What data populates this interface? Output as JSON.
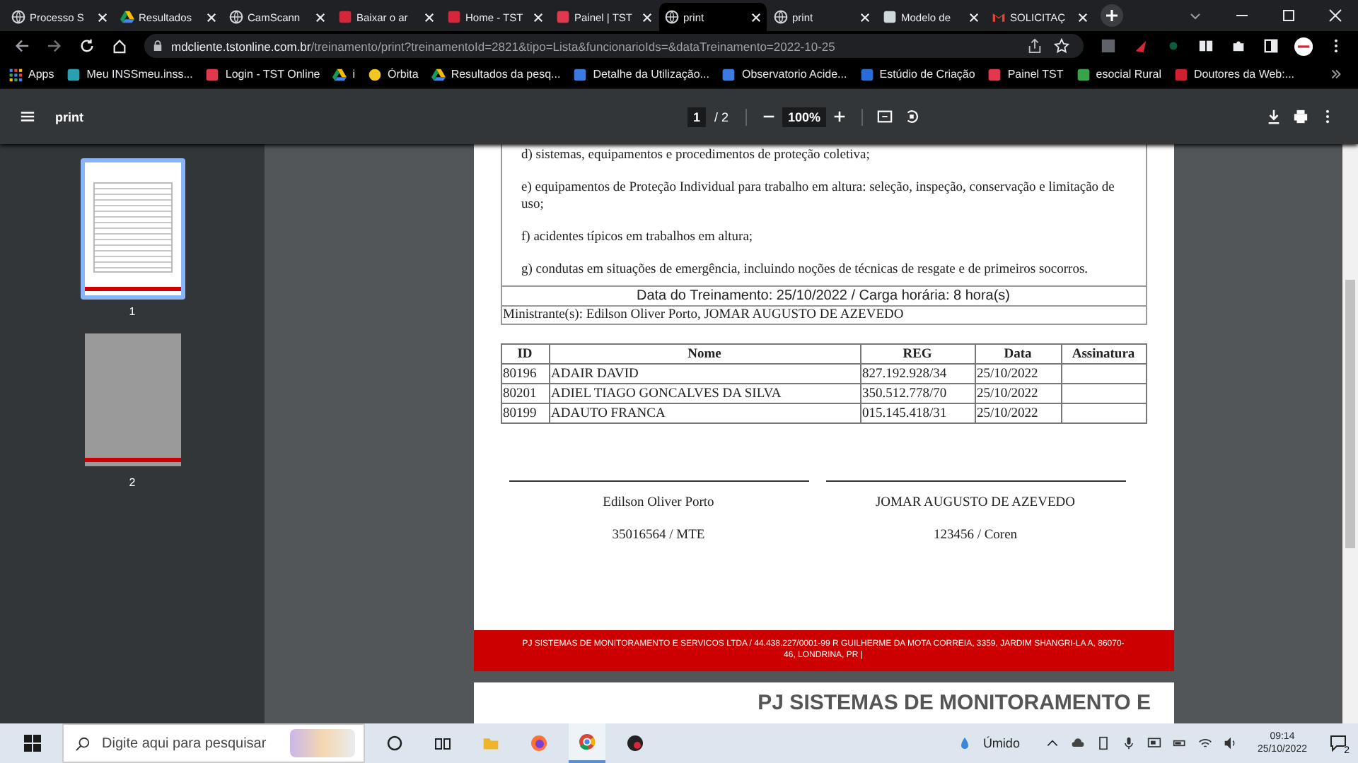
{
  "tabs": [
    {
      "title": "Processo S",
      "kind": "globe",
      "selected": false
    },
    {
      "title": "Resultados",
      "kind": "drive",
      "selected": false
    },
    {
      "title": "CamScann",
      "kind": "globe",
      "selected": false
    },
    {
      "title": "Baixar o ar",
      "kind": "heart",
      "selected": false
    },
    {
      "title": "Home - TST",
      "kind": "heart",
      "selected": false
    },
    {
      "title": "Painel | TST",
      "kind": "tst",
      "selected": false
    },
    {
      "title": "print",
      "kind": "globe",
      "selected": true
    },
    {
      "title": "print",
      "kind": "globe",
      "selected": false
    },
    {
      "title": "Modelo de",
      "kind": "doc",
      "selected": false
    },
    {
      "title": "SOLICITAÇ",
      "kind": "gmail",
      "selected": false
    }
  ],
  "address": {
    "host": "mdcliente.tstonline.com.br",
    "path": "/treinamento/print?treinamentoId=2821&tipo=Lista&funcionarioIds=&dataTreinamento=2022-10-25"
  },
  "bookmarks": [
    {
      "label": "Apps",
      "kind": "grid"
    },
    {
      "label": "Meu INSSmeu.inss...",
      "kind": "teal"
    },
    {
      "label": "Login - TST Online",
      "kind": "tst"
    },
    {
      "label": "i",
      "kind": "drive"
    },
    {
      "label": "Órbita",
      "kind": "yellow"
    },
    {
      "label": "Resultados da pesq...",
      "kind": "drive"
    },
    {
      "label": "Detalhe da Utilização...",
      "kind": "blue"
    },
    {
      "label": "Observatorio Acide...",
      "kind": "blue"
    },
    {
      "label": "Estúdio de Criação",
      "kind": "meta"
    },
    {
      "label": "Painel TST",
      "kind": "tst"
    },
    {
      "label": "esocial Rural",
      "kind": "green"
    },
    {
      "label": "Doutores da Web:...",
      "kind": "red"
    }
  ],
  "pdf_toolbar": {
    "title": "print",
    "page": "1",
    "page_total": "/ 2",
    "zoom": "100%"
  },
  "thumbnails": [
    {
      "label": "1",
      "selected": true
    },
    {
      "label": "2",
      "selected": false
    }
  ],
  "document": {
    "topics": [
      "d) sistemas, equipamentos e procedimentos de proteção coletiva;",
      "e) equipamentos de Proteção Individual para trabalho em altura: seleção, inspeção, conservação e limitação de uso;",
      "f) acidentes típicos em trabalhos em altura;",
      "g) condutas em situações de emergência, incluindo noções de técnicas de resgate e de primeiros socorros."
    ],
    "training_line": "Data do Treinamento: 25/10/2022 / Carga horária: 8 hora(s)",
    "instructors": "Ministrante(s): Edilson Oliver Porto, JOMAR AUGUSTO DE AZEVEDO",
    "table": {
      "columns": [
        "ID",
        "Nome",
        "REG",
        "Data",
        "Assinatura"
      ],
      "rows": [
        [
          "80196",
          "ADAIR DAVID",
          "827.192.928/34",
          "25/10/2022",
          ""
        ],
        [
          "80201",
          "ADIEL TIAGO GONCALVES DA SILVA",
          "350.512.778/70",
          "25/10/2022",
          ""
        ],
        [
          "80199",
          "ADAUTO FRANCA",
          "015.145.418/31",
          "25/10/2022",
          ""
        ]
      ]
    },
    "signatures": [
      {
        "name": "Edilson Oliver Porto",
        "reg": "35016564 / MTE"
      },
      {
        "name": "JOMAR AUGUSTO DE AZEVEDO",
        "reg": "123456 / Coren"
      }
    ],
    "footer": "PJ SISTEMAS DE MONITORAMENTO E SERVICOS LTDA / 44.438.227/0001-99 R GUILHERME DA MOTA CORREIA, 3359, JARDIM SHANGRI-LA A, 86070-46, LONDRINA, PR |",
    "next_page_heading": "PJ SISTEMAS DE MONITORAMENTO E"
  },
  "taskbar": {
    "search_placeholder": "Digite aqui para pesquisar",
    "weather": "Úmido",
    "time": "09:14",
    "date": "25/10/2022",
    "notifications": "2"
  }
}
